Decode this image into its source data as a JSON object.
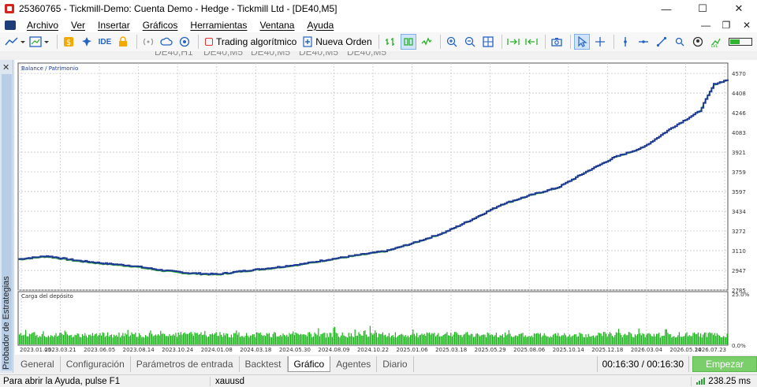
{
  "window": {
    "title": "25360765 - Tickmill-Demo: Cuenta Demo - Hedge - Tickmill Ltd - [DE40,M5]",
    "minimize": "—",
    "maximize": "☐",
    "close": "✕"
  },
  "menu": {
    "items": [
      "Archivo",
      "Ver",
      "Insertar",
      "Gráficos",
      "Herramientas",
      "Ventana",
      "Ayuda"
    ],
    "ctrl_min": "—",
    "ctrl_restore": "❐",
    "ctrl_close": "✕"
  },
  "toolbar": {
    "ide_label": "IDE",
    "algo_trading": "Trading algorítmico",
    "new_order": "Nueva Orden",
    "battery_level": 0.45
  },
  "chart_tabs": [
    "DE40,H1",
    "DE40,M5",
    "DE40,M5",
    "DE40,M5",
    "DE40,M5"
  ],
  "side_panel": {
    "label": "Probador de Estrategias",
    "close": "✕"
  },
  "chart_data": [
    {
      "type": "line",
      "legend": "Balance / Patrimonio",
      "series": [
        {
          "name": "Balance",
          "color": "#1f3a93"
        },
        {
          "name": "Patrimonio",
          "color": "#2db32d"
        }
      ],
      "ylim": [
        2785,
        4655
      ],
      "y_ticks": [
        4570,
        4408,
        4246,
        4083,
        3921,
        3759,
        3597,
        3434,
        3272,
        3110,
        2947,
        2785
      ],
      "x": [
        0,
        0.04,
        0.08,
        0.12,
        0.16,
        0.2,
        0.24,
        0.28,
        0.32,
        0.36,
        0.4,
        0.44,
        0.48,
        0.52,
        0.56,
        0.6,
        0.64,
        0.68,
        0.72,
        0.76,
        0.8,
        0.84,
        0.88,
        0.92,
        0.96,
        0.98,
        1.0
      ],
      "values": [
        3040,
        3065,
        3030,
        3005,
        2985,
        2950,
        2925,
        2915,
        2945,
        2970,
        3000,
        3040,
        3075,
        3110,
        3180,
        3260,
        3370,
        3490,
        3565,
        3630,
        3760,
        3880,
        3960,
        4120,
        4260,
        4480,
        4520
      ]
    },
    {
      "type": "bar",
      "title": "Carga del depósito",
      "color": "#17b317",
      "y_ticks": [
        "25.0%",
        "0.0%"
      ],
      "ylim": [
        0,
        25
      ]
    }
  ],
  "x_axis_labels": [
    "2023.01.05",
    "2023.03.21",
    "2023.06.05",
    "2023.08.14",
    "2023.10.24",
    "2024.01.08",
    "2024.03.18",
    "2024.05.30",
    "2024.08.09",
    "2024.10.22",
    "2025.01.06",
    "2025.03.18",
    "2025.05.29",
    "2025.08.06",
    "2025.10.14",
    "2025.12.18",
    "2026.03.04",
    "2026.05.14",
    "2026.07.23"
  ],
  "bottom_tabs": [
    "General",
    "Configuración",
    "Parámetros de entrada",
    "Backtest",
    "Gráfico",
    "Agentes",
    "Diario"
  ],
  "active_tab": "Gráfico",
  "timer": "00:16:30 / 00:16:30",
  "start_button": "Empezar",
  "status": {
    "help": "Para abrir la Ayuda, pulse F1",
    "symbol": "xauusd",
    "ping": "238.25 ms"
  },
  "colors": {
    "accent": "#2563c4",
    "start_button": "#7bcf6a",
    "grid": "#c9c9c9"
  }
}
